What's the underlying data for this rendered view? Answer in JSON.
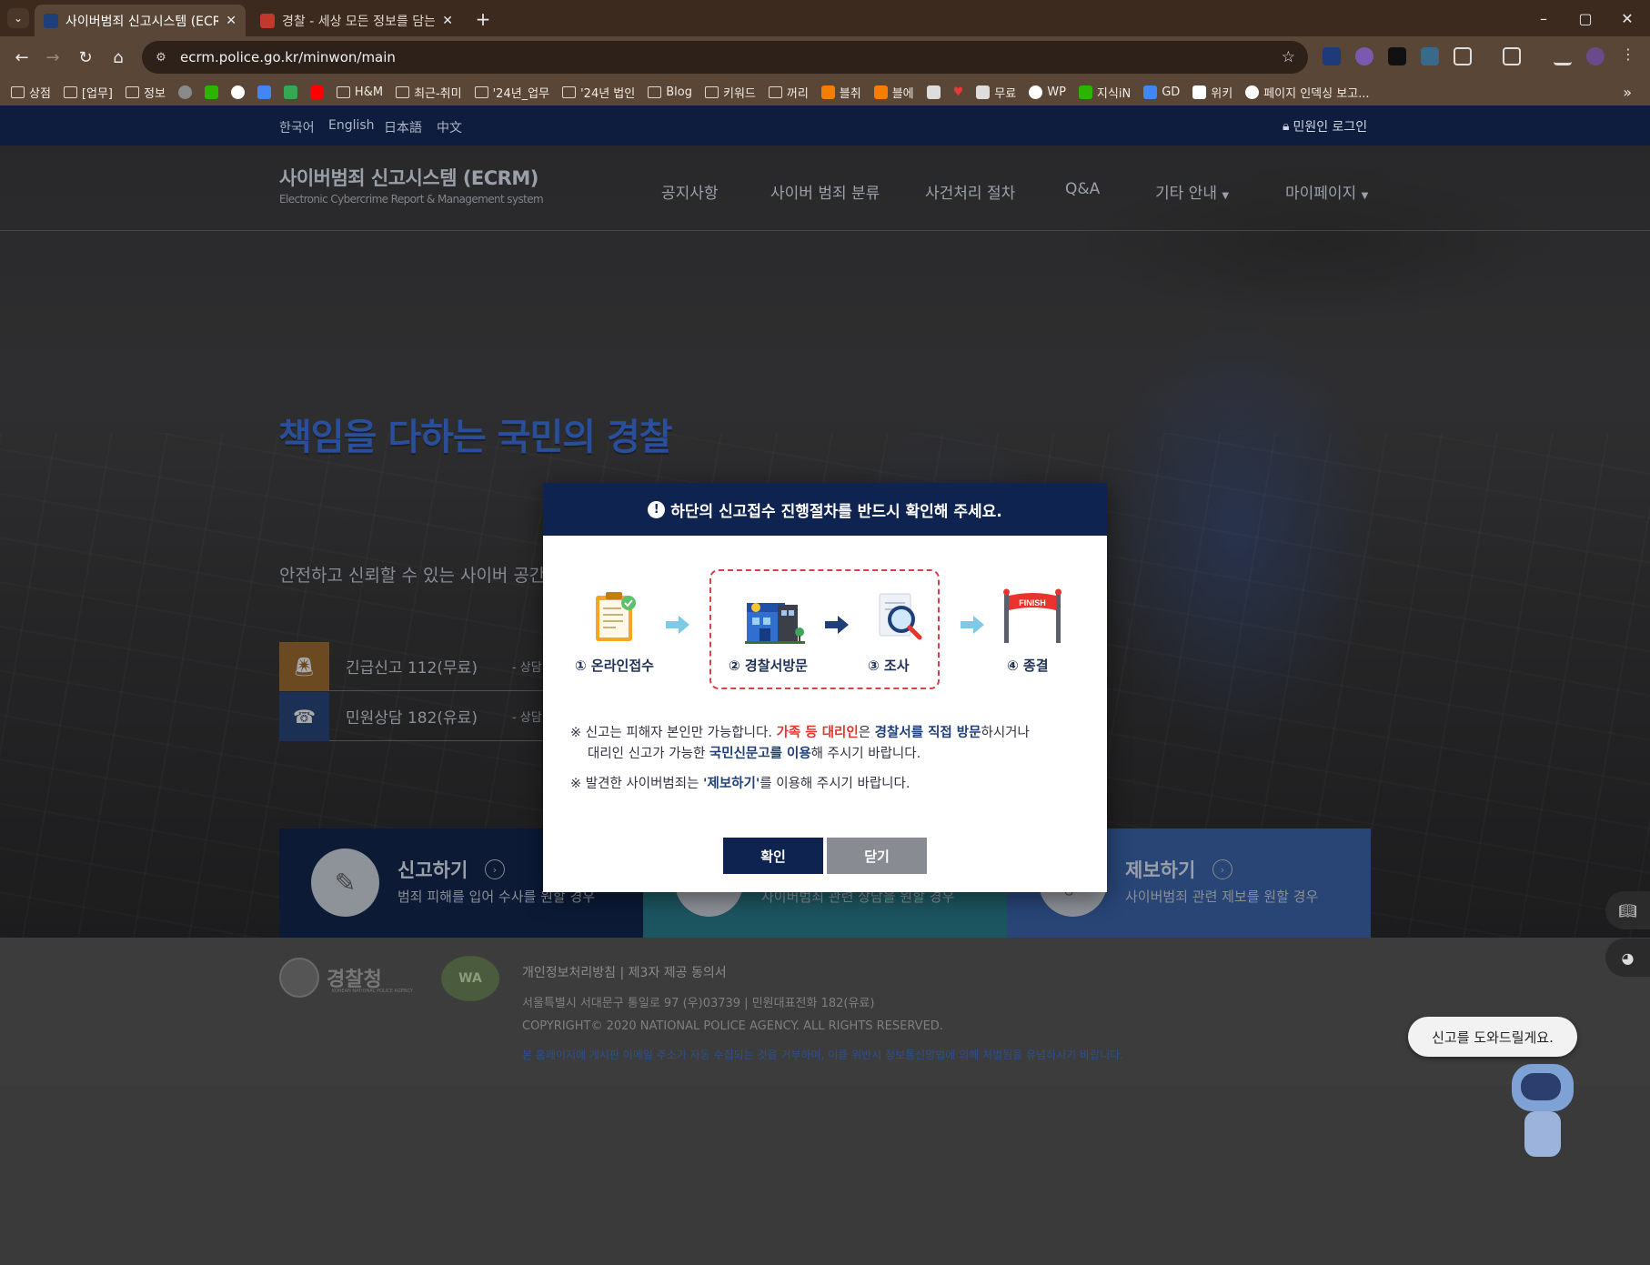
{
  "browser": {
    "tabs": [
      {
        "title": "사이버범죄 신고시스템 (ECRM)",
        "active": true
      },
      {
        "title": "경찰 - 세상 모든 정보를 담는",
        "active": false
      }
    ],
    "url": "ecrm.police.go.kr/minwon/main",
    "bookmarks": [
      "상점",
      "[업무]",
      "정보",
      "H&M",
      "최근-취미",
      "'24년_업무",
      "'24년 법인",
      "Blog",
      "키워드",
      "꺼리",
      "블취",
      "블에",
      "무료",
      "WP",
      "지식iN",
      "GD",
      "위키",
      "페이지 인덱싱 보고..."
    ]
  },
  "header": {
    "languages": [
      "한국어",
      "English",
      "日本語",
      "中文"
    ],
    "login": "민원인 로그인",
    "site_title": "사이버범죄 신고시스템 (ECRM)",
    "site_subtitle": "Electronic Cybercrime Report & Management system",
    "nav": [
      "공지사항",
      "사이버 범죄 분류",
      "사건처리 절차",
      "Q&A",
      "기타 안내",
      "마이페이지"
    ]
  },
  "hero": {
    "slogan": "책임을 다하는 국민의 경찰",
    "subslogan": "안전하고 신뢰할 수 있는 사이버 공간",
    "contacts": [
      {
        "label": "긴급신고 112(무료)",
        "sub": "- 상담",
        "color": "#a8691c"
      },
      {
        "label": "민원상담 182(유료)",
        "sub": "- 상담",
        "color": "#1f3f7a"
      }
    ]
  },
  "actions": [
    {
      "title": "신고하기",
      "desc": "범죄 피해를 입어 수사를 원할 경우",
      "color": "#132750"
    },
    {
      "title": "",
      "desc": "사이버범죄 관련 상담을 원할 경우",
      "color": "#2c7a8a"
    },
    {
      "title": "제보하기",
      "desc": "사이버범죄 관련 제보를 원할 경우",
      "color": "#3a5fa0"
    }
  ],
  "footer": {
    "agency": "경찰청",
    "agency_en": "KOREAN NATIONAL POLICE AGENCY",
    "links": "개인정보처리방침   |   제3자 제공 동의서",
    "address": "서울특별시 서대문구 통일로 97 (우)03739   |   민원대표전화 182(유료)",
    "copyright": "COPYRIGHT© 2020 NATIONAL POLICE AGENCY. ALL RIGHTS RESERVED.",
    "warning": "본 홈페이지에 게시판 이메일 주소가 자동 수집되는 것을 거부하며, 이를 위반시 정보통신망법에 의해 처벌됨을 유념하시기 바랍니다."
  },
  "chat": {
    "bubble": "신고를 도와드릴게요."
  },
  "modal": {
    "title": "하단의 신고접수 진행절차를 반드시 확인해 주세요.",
    "steps": [
      "① 온라인접수",
      "② 경찰서방문",
      "③ 조사",
      "④ 종결"
    ],
    "finish_label": "FINISH",
    "note1_a": "※ 신고는 피해자 본인만 가능합니다. ",
    "note1_red": "가족 등 대리인",
    "note1_b": "은 ",
    "note1_blue1": "경찰서를 직접 방문",
    "note1_c": "하시거나",
    "note1_d": "대리인 신고가 가능한 ",
    "note1_blue2": "국민신문고를 이용",
    "note1_e": "해 주시기 바랍니다.",
    "note2_a": "※ 발견한 사이버범죄는 ",
    "note2_blue": "'제보하기'",
    "note2_b": "를 이용해 주시기 바랍니다.",
    "ok": "확인",
    "close": "닫기"
  }
}
